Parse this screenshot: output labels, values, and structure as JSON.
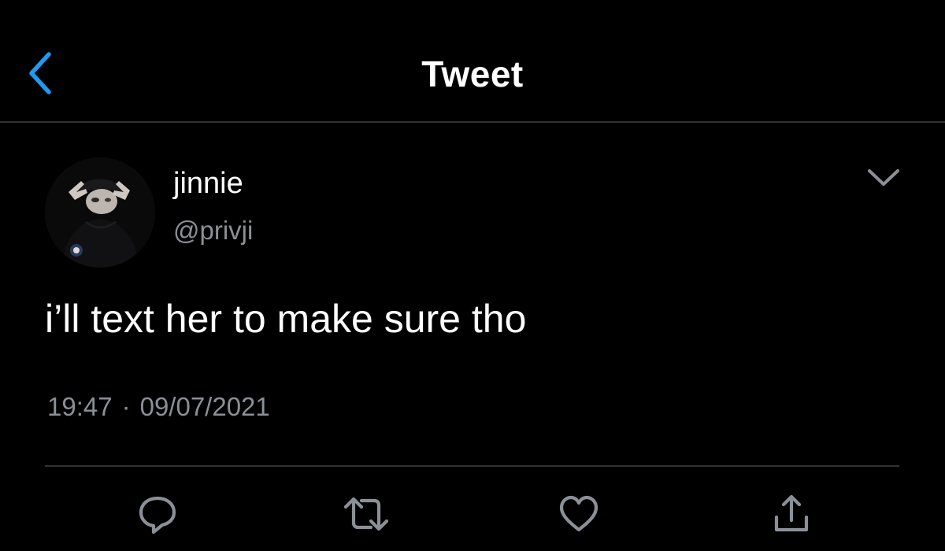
{
  "header": {
    "title": "Tweet",
    "back_icon": "chevron-left-icon"
  },
  "tweet": {
    "author": {
      "display_name": "jinnie",
      "handle": "@privji",
      "avatar_icon": "profile-photo"
    },
    "more_icon": "chevron-down-icon",
    "text": "i’ll text her to make sure tho",
    "time": "19:47",
    "separator": "·",
    "date": "09/07/2021"
  },
  "actions": [
    {
      "name": "reply",
      "icon": "speech-bubble-icon"
    },
    {
      "name": "retweet",
      "icon": "retweet-icon"
    },
    {
      "name": "like",
      "icon": "heart-icon"
    },
    {
      "name": "share",
      "icon": "share-icon"
    }
  ],
  "colors": {
    "background": "#000000",
    "accent": "#1d9bf0",
    "text_primary": "#ffffff",
    "text_secondary": "#8b9096",
    "divider": "#2f3336",
    "icon": "#8b9096"
  }
}
